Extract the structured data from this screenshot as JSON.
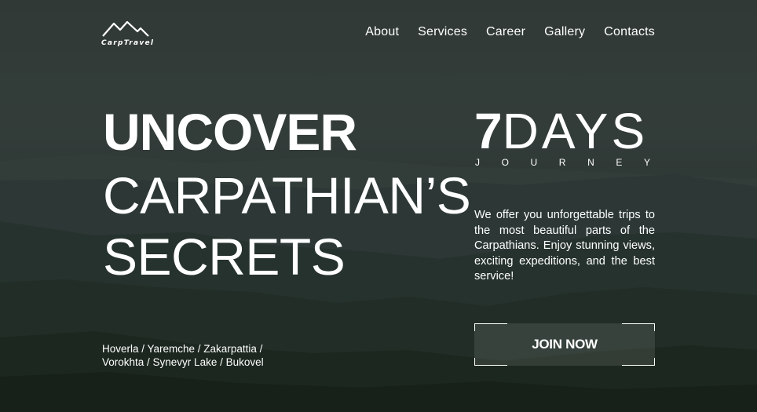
{
  "brand": {
    "name": "CarpTravel",
    "logo_icon": "mountain-logo-icon"
  },
  "nav": {
    "items": [
      {
        "label": "About"
      },
      {
        "label": "Services"
      },
      {
        "label": "Career"
      },
      {
        "label": "Gallery"
      },
      {
        "label": "Contacts"
      }
    ]
  },
  "hero": {
    "title_bold": "UNCOVER",
    "title_line2": "CARPATHIAN’S",
    "title_line3": "SECRETS",
    "days_number": "7",
    "days_word": "DAYS",
    "journey_letters": [
      "J",
      "O",
      "U",
      "R",
      "N",
      "E",
      "Y"
    ],
    "description": "We offer you unforgettable trips to the most beautiful parts of the Carpathians. Enjoy stunning views, exciting expeditions, and the best service!",
    "places_line1": "Hoverla / Yaremche / Zakarpattia /",
    "places_line2": "Vorokhta / Synevyr Lake / Bukovel",
    "cta_label": "JOIN NOW"
  },
  "colors": {
    "text": "#ffffff",
    "background": "#2f3a36"
  }
}
